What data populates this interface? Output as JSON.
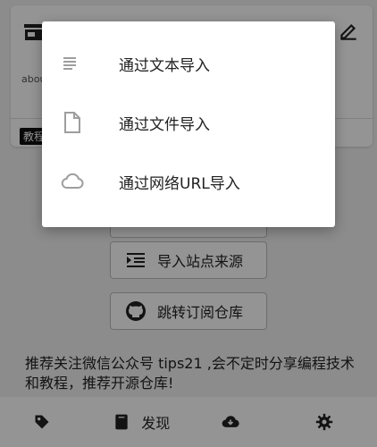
{
  "card": {
    "about_text": "abou",
    "tag_label": "教程"
  },
  "buttons": {
    "import_sources_label": "导入站点来源",
    "jump_repo_label": "跳转订阅仓库"
  },
  "notice_text": "推荐关注微信公众号 tips21 ,会不定时分享编程技术和教程，推荐开源仓库!",
  "bottom_nav": {
    "items": [
      {
        "icon": "tag-icon",
        "label": ""
      },
      {
        "icon": "book-icon",
        "label": "发现"
      },
      {
        "icon": "cloud-download-icon",
        "label": ""
      },
      {
        "icon": "gear-icon",
        "label": ""
      }
    ]
  },
  "menu": {
    "items": [
      {
        "icon": "text-lines-icon",
        "label": "通过文本导入"
      },
      {
        "icon": "file-icon",
        "label": "通过文件导入"
      },
      {
        "icon": "cloud-icon",
        "label": "通过网络URL导入"
      }
    ]
  },
  "colors": {
    "scrim": "#000000",
    "menu_background": "#ffffff",
    "icon_gray": "#9e9e9e"
  }
}
